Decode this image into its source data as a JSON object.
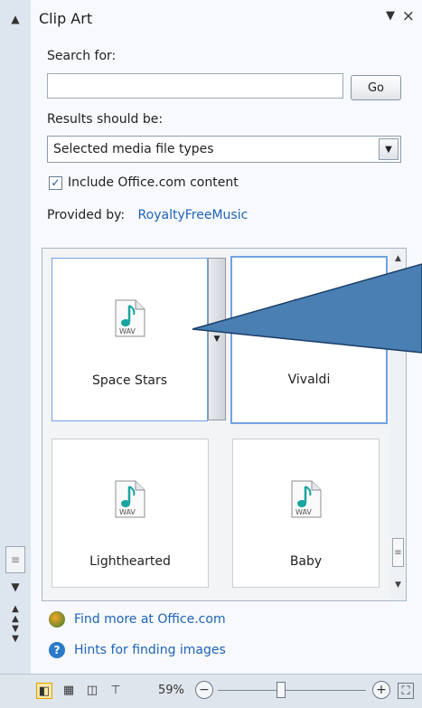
{
  "pane": {
    "title": "Clip Art",
    "dropdown_glyph": "▼",
    "close_glyph": "×"
  },
  "search": {
    "label": "Search for:",
    "value": "",
    "go_label": "Go"
  },
  "results_filter": {
    "label": "Results should be:",
    "selected": "Selected media file types"
  },
  "include_office": {
    "checked": true,
    "label": "Include Office.com content"
  },
  "provider": {
    "label": "Provided by:",
    "name": "RoyaltyFreeMusic"
  },
  "results": [
    {
      "name": "Space Stars",
      "type": "WAV",
      "selected": true
    },
    {
      "name": "Vivaldi",
      "type": "WAV",
      "selected": true
    },
    {
      "name": "Lighthearted",
      "type": "WAV",
      "selected": false
    },
    {
      "name": "Baby",
      "type": "WAV",
      "selected": false
    }
  ],
  "footer": {
    "find_more": "Find more at Office.com",
    "hints": "Hints for finding images"
  },
  "statusbar": {
    "zoom": "59%"
  },
  "colors": {
    "link": "#1f63b8",
    "selection_border": "#6ea3e3",
    "callout": "#4a7fb3"
  },
  "icons": [
    "scroll-up-arrow-icon",
    "scroll-down-arrow-icon",
    "wav-audio-file-icon",
    "office-globe-icon",
    "help-question-icon",
    "normal-view-icon",
    "slide-sorter-icon",
    "reading-view-icon",
    "slide-show-icon",
    "fit-to-window-icon"
  ]
}
